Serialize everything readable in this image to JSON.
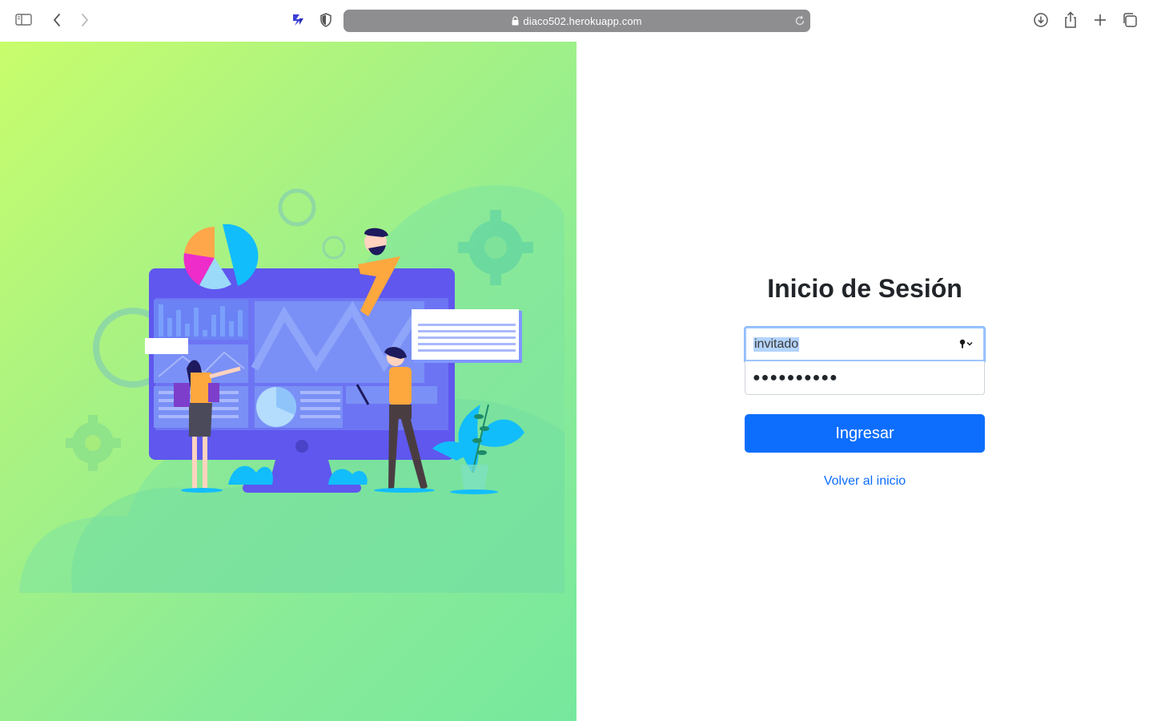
{
  "browser": {
    "url": "diaco502.herokuapp.com"
  },
  "login": {
    "title": "Inicio de Sesión",
    "username_value": "invitado",
    "password_mask": "●●●●●●●●●●",
    "submit_label": "Ingresar",
    "back_link": "Volver al inicio"
  },
  "colors": {
    "primary": "#0d6efd",
    "gradient_start": "#c8fd6c",
    "gradient_end": "#76e89d",
    "monitor": "#5f57ee"
  }
}
